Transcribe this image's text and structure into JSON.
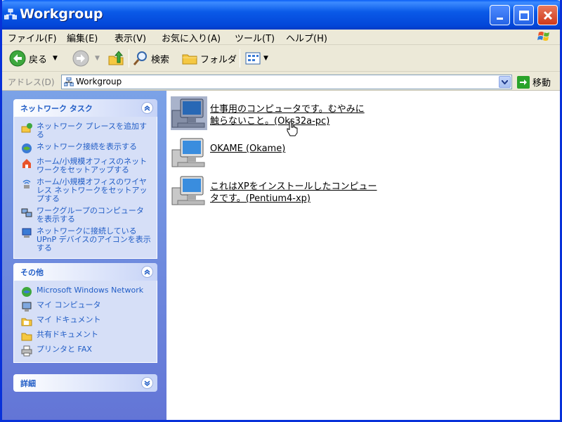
{
  "window": {
    "title": "Workgroup"
  },
  "menubar": {
    "items": [
      "ファイル(F)",
      "編集(E)",
      "表示(V)",
      "お気に入り(A)",
      "ツール(T)",
      "ヘルプ(H)"
    ]
  },
  "toolbar": {
    "back_label": "戻る",
    "search_label": "検索",
    "folders_label": "フォルダ"
  },
  "addressbar": {
    "label": "アドレス(D)",
    "value": "Workgroup",
    "go_label": "移動"
  },
  "taskpane": {
    "network_tasks": {
      "title": "ネットワーク タスク",
      "items": [
        "ネットワーク プレースを追加する",
        "ネットワーク接続を表示する",
        "ホーム/小規模オフィスのネットワークをセットアップする",
        "ホーム/小規模オフィスのワイヤレス ネットワークをセットアップする",
        "ワークグループのコンピュータを表示する",
        "ネットワークに接続している UPnP デバイスのアイコンを表示する"
      ]
    },
    "other_places": {
      "title": "その他",
      "items": [
        "Microsoft Windows Network",
        "マイ コンピュータ",
        "マイ ドキュメント",
        "共有ドキュメント",
        "プリンタと FAX"
      ]
    },
    "details": {
      "title": "詳細"
    }
  },
  "content": {
    "computers": [
      {
        "line1": "仕事用のコンピュータです。むやみに",
        "line2": "触らないこと。(Oks32a-pc)",
        "selected": true
      },
      {
        "line1": "OKAME (Okame)",
        "line2": "",
        "selected": false
      },
      {
        "line1": "これはXPをインストールしたコンピュー",
        "line2": "タです。(Pentium4-xp)",
        "selected": false
      }
    ]
  },
  "colors": {
    "titlebar": "#0a5ae8",
    "taskpane_bg": "#7ba2e7",
    "selection": "#0a246a",
    "link": "#215dc6"
  }
}
